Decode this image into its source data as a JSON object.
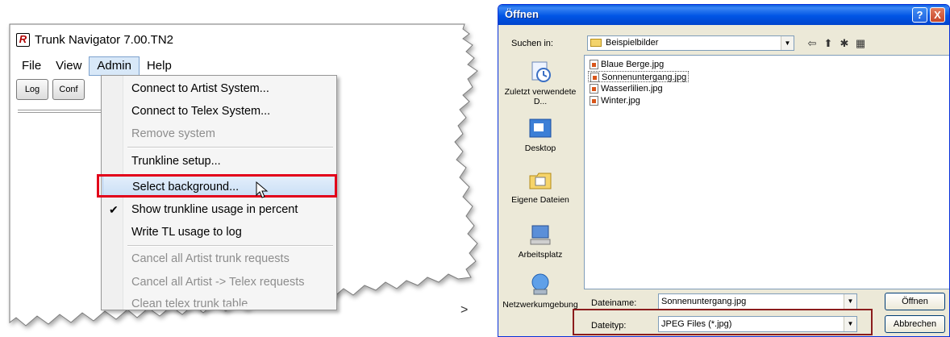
{
  "left_app": {
    "title": "Trunk Navigator 7.00.TN2",
    "menu": [
      "File",
      "View",
      "Admin",
      "Help"
    ],
    "active_menu": "Admin",
    "toolbar": [
      "Log",
      "Conf"
    ],
    "dropdown": [
      {
        "label": "Connect to Artist System...",
        "state": "enabled"
      },
      {
        "label": "Connect to Telex System...",
        "state": "enabled"
      },
      {
        "label": "Remove system",
        "state": "disabled"
      },
      {
        "label": "Trunkline setup...",
        "state": "enabled"
      },
      {
        "label": "Select background...",
        "state": "highlighted"
      },
      {
        "label": "Show trunkline usage in percent",
        "state": "checked"
      },
      {
        "label": "Write TL usage to log",
        "state": "enabled"
      },
      {
        "label": "Cancel all Artist trunk requests",
        "state": "disabled"
      },
      {
        "label": "Cancel all Artist -> Telex requests",
        "state": "disabled"
      },
      {
        "label": "Clean telex trunk table",
        "state": "disabled"
      }
    ],
    "separator_marker": ">"
  },
  "dialog": {
    "title": "Öffnen",
    "help_button": "?",
    "close_button": "X",
    "look_in_label": "Suchen in:",
    "look_in_value": "Beispielbilder",
    "places": [
      "Zuletzt verwendete D...",
      "Desktop",
      "Eigene Dateien",
      "Arbeitsplatz",
      "Netzwerkumgebung"
    ],
    "files": [
      "Blaue Berge.jpg",
      "Sonnenuntergang.jpg",
      "Wasserlilien.jpg",
      "Winter.jpg"
    ],
    "selected_file": "Sonnenuntergang.jpg",
    "filename_label": "Dateiname:",
    "filename_value": "Sonnenuntergang.jpg",
    "filetype_label": "Dateityp:",
    "filetype_value": "JPEG Files (*.jpg)",
    "open_button": "Öffnen",
    "cancel_button": "Abbrechen"
  },
  "colors": {
    "highlight_box": "#e2001a",
    "xp_titlebar": "#0055e5",
    "filetype_highlight": "#8b1c1c"
  }
}
